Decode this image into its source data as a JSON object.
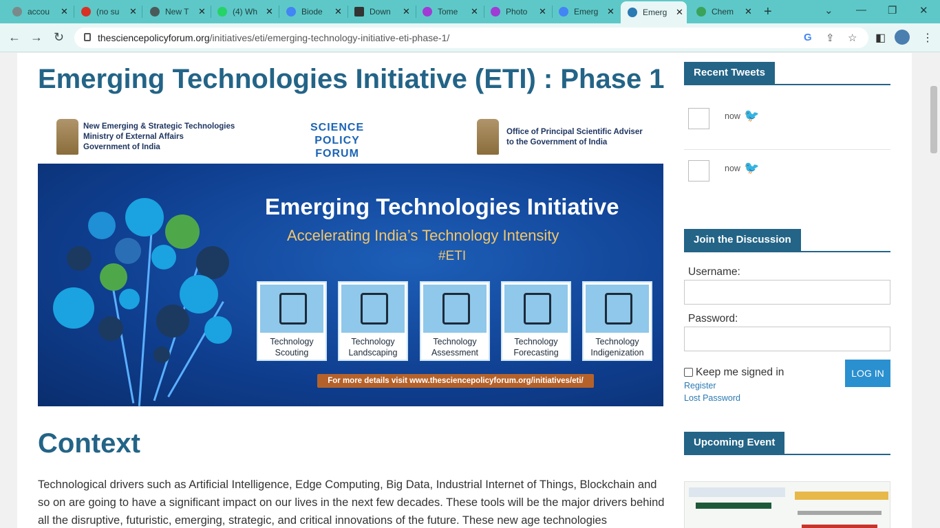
{
  "browser": {
    "tabs": [
      {
        "label": "accou",
        "icon": "account-icon",
        "color": "#7a8a8a"
      },
      {
        "label": "(no su",
        "icon": "gmail-icon",
        "color": "#d93025"
      },
      {
        "label": "New T",
        "icon": "chrome-icon",
        "color": "#4a5a5a"
      },
      {
        "label": "(4) Wh",
        "icon": "whatsapp-icon",
        "color": "#25d366"
      },
      {
        "label": "Biode",
        "icon": "google-icon",
        "color": "#4285f4"
      },
      {
        "label": "Down",
        "icon": "download-icon",
        "color": "#333333"
      },
      {
        "label": "Tome",
        "icon": "tome-icon",
        "color": "#a13bd6"
      },
      {
        "label": "Photo",
        "icon": "photo-icon",
        "color": "#a13bd6"
      },
      {
        "label": "Emerg",
        "icon": "google-icon",
        "color": "#4285f4"
      },
      {
        "label": "Emerg",
        "icon": "site-icon",
        "color": "#2a7ab3",
        "active": true
      },
      {
        "label": "Chem",
        "icon": "chem-icon",
        "color": "#3aa35a"
      }
    ],
    "url_host": "thesciencepolicyforum.org",
    "url_path": "/initiatives/eti/emerging-technology-initiative-eti-phase-1/"
  },
  "article": {
    "title": "Emerging Technologies Initiative (ETI) : Phase 1",
    "banner": {
      "left_org_line1": "New Emerging & Strategic Technologies",
      "left_org_line2": "Ministry of External Affairs",
      "left_org_line3": "Government of India",
      "spf_line1": "SCIENCE",
      "spf_line2": "POLICY",
      "spf_line3": "FORUM",
      "right_org_line1": "Office of Principal Scientific Adviser",
      "right_org_line2": "to the Government of India",
      "heading": "Emerging Technologies Initiative",
      "subheading": "Accelerating India’s Technology Intensity",
      "hashtag": "#ETI",
      "cards": [
        {
          "line1": "Technology",
          "line2": "Scouting"
        },
        {
          "line1": "Technology",
          "line2": "Landscaping"
        },
        {
          "line1": "Technology",
          "line2": "Assessment"
        },
        {
          "line1": "Technology",
          "line2": "Forecasting"
        },
        {
          "line1": "Technology",
          "line2": "Indigenization"
        }
      ],
      "footer": "For more details visit www.thesciencepolicyforum.org/initiatives/eti/"
    },
    "context_heading": "Context",
    "context_text": "Technological drivers such as Artificial Intelligence, Edge Computing, Big Data, Industrial Internet of Things, Blockchain and so on are going to have a significant impact on our lives in the next few decades. These tools will be the major drivers behind all the disruptive, futuristic, emerging, strategic, and critical innovations of the future. These new age technologies"
  },
  "sidebar": {
    "recent_tweets_title": "Recent Tweets",
    "tweets": [
      {
        "time": "now"
      },
      {
        "time": "now"
      }
    ],
    "join_title": "Join the Discussion",
    "username_label": "Username:",
    "password_label": "Password:",
    "keep_signed_in": "Keep me signed in",
    "login_button": "LOG IN",
    "register_link": "Register",
    "lost_password_link": "Lost Password",
    "upcoming_title": "Upcoming Event"
  }
}
